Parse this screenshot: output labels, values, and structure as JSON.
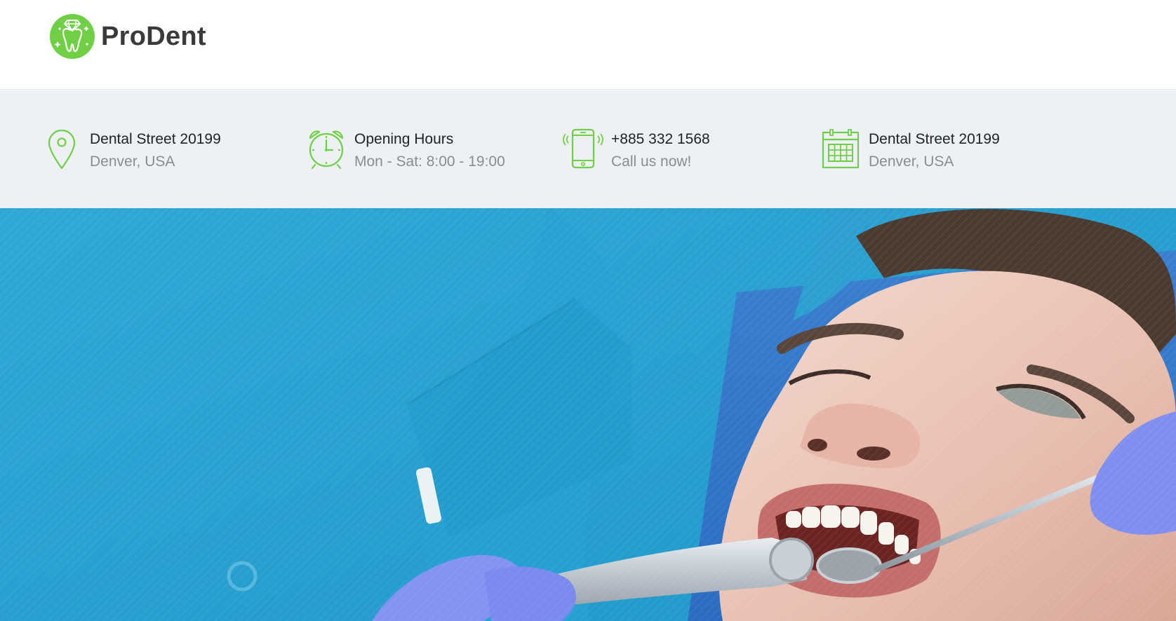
{
  "brand": {
    "name": "ProDent",
    "accent": "#6fd046",
    "logo_icon": "tooth-diamond-icon"
  },
  "info": [
    {
      "icon": "map-pin-icon",
      "title": "Dental Street 20199",
      "sub": "Denver, USA"
    },
    {
      "icon": "alarm-clock-icon",
      "title": "Opening Hours",
      "sub": "Mon - Sat: 8:00 - 19:00"
    },
    {
      "icon": "mobile-phone-icon",
      "title": "+885 332 1568",
      "sub": "Call us now!"
    },
    {
      "icon": "calendar-icon",
      "title": "Dental Street 20199",
      "sub": "Denver, USA"
    }
  ],
  "hero": {
    "image": "dental-patient-photo",
    "colors": {
      "scrubs": "#2aa2d2",
      "glove": "#7f8ff0"
    }
  }
}
